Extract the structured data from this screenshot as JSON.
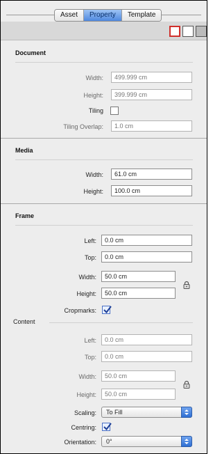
{
  "tabs": [
    {
      "label": "Asset",
      "active": false
    },
    {
      "label": "Property",
      "active": true
    },
    {
      "label": "Template",
      "active": false
    }
  ],
  "document": {
    "title": "Document",
    "width_label": "Width:",
    "width_value": "499.999 cm",
    "height_label": "Height:",
    "height_value": "399.999 cm",
    "tiling_label": "Tiling",
    "tiling_overlap_label": "Tiling Overlap:",
    "tiling_overlap_value": "1.0 cm"
  },
  "media": {
    "title": "Media",
    "width_label": "Width:",
    "width_value": "61.0 cm",
    "height_label": "Height:",
    "height_value": "100.0 cm"
  },
  "frame": {
    "title": "Frame",
    "left_label": "Left:",
    "left_value": "0.0 cm",
    "top_label": "Top:",
    "top_value": "0.0 cm",
    "width_label": "Width:",
    "width_value": "50.0 cm",
    "height_label": "Height:",
    "height_value": "50.0 cm",
    "cropmarks_label": "Cropmarks:"
  },
  "content": {
    "title": "Content",
    "left_label": "Left:",
    "left_value": "0.0 cm",
    "top_label": "Top:",
    "top_value": "0.0 cm",
    "width_label": "Width:",
    "width_value": "50.0 cm",
    "height_label": "Height:",
    "height_value": "50.0 cm",
    "scaling_label": "Scaling:",
    "scaling_value": "To Fill",
    "centring_label": "Centring:",
    "orientation_label": "Orientation:",
    "orientation_value": "0°"
  }
}
